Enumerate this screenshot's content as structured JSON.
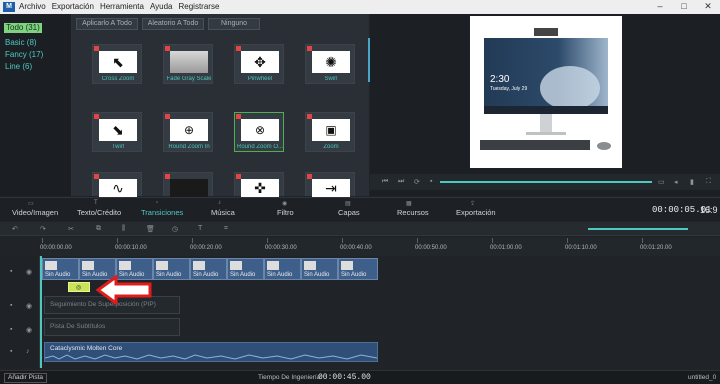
{
  "menu": {
    "logo": "M",
    "items": [
      "Archivo",
      "Exportación",
      "Herramienta",
      "Ayuda",
      "Registrarse"
    ],
    "window_controls": [
      "–",
      "□",
      "✕"
    ]
  },
  "categories": [
    {
      "label": "Todo (31)",
      "selected": true
    },
    {
      "label": "Basic (8)"
    },
    {
      "label": "Fancy (17)"
    },
    {
      "label": "Line (6)"
    }
  ],
  "effects_toolbar": {
    "apply_all": "Aplicarlo A Todo",
    "random_all": "Aleatorio A Todo",
    "none": "Ninguno"
  },
  "transitions": [
    {
      "label": "Cross Zoom",
      "icon": "arrow-corner-icon"
    },
    {
      "label": "Fade Gray Scale",
      "icon": "gray-fade-icon"
    },
    {
      "label": "Pinwheel",
      "icon": "pinwheel-icon"
    },
    {
      "label": "Swirl",
      "icon": "swirl-icon"
    },
    {
      "label": "Twirl",
      "icon": "twirl-icon"
    },
    {
      "label": "Round Zoom In",
      "icon": "zoom-in-arrows-icon"
    },
    {
      "label": "Round Zoom O...",
      "icon": "zoom-out-arrows-icon",
      "selected": true
    },
    {
      "label": "Zoom",
      "icon": "zoom-rect-icon"
    },
    {
      "label": "",
      "icon": "wave-icon"
    },
    {
      "label": "",
      "icon": "blob-icon"
    },
    {
      "label": "",
      "icon": "cross-arrows-icon"
    },
    {
      "label": "",
      "icon": "arrow-into-box-icon"
    }
  ],
  "preview": {
    "time_display": "2:30",
    "date_display": "Tuesday, July 29"
  },
  "tabs": [
    {
      "label": "Video/Imagen"
    },
    {
      "label": "Texto/Crédito"
    },
    {
      "label": "Transiciones",
      "active": true
    },
    {
      "label": "Música"
    },
    {
      "label": "Filtro"
    },
    {
      "label": "Capas"
    },
    {
      "label": "Recursos"
    },
    {
      "label": "Exportación"
    }
  ],
  "timecode": "00:00:05.01",
  "aspect_ratio": "16:9",
  "ruler_ticks": [
    "00:00:00.00",
    "00:00:10.00",
    "00:00:20.00",
    "00:00:30.00",
    "00:00:40.00",
    "00:00:50.00",
    "00:01:00.00",
    "00:01:10.00",
    "00:01:20.00"
  ],
  "clips": [
    {
      "label": "Sin Audio"
    },
    {
      "label": "Sin Audio"
    },
    {
      "label": "Sin Audio"
    },
    {
      "label": "Sin Audio"
    },
    {
      "label": "Sin Audio"
    },
    {
      "label": "Sin Audio"
    },
    {
      "label": "Sin Audio"
    },
    {
      "label": "Sin Audio"
    },
    {
      "label": "Sin Audio"
    }
  ],
  "tracks": {
    "pip": "Seguimiento De Superposición (PIP)",
    "subtitles": "Pista De Subtítulos",
    "audio": "Cataclysmic Molten Core"
  },
  "status": {
    "add_track": "Añadir Pista",
    "project_time_label": "Tiempo De Ingeniería:",
    "project_time": "00:00:45.00",
    "project_name": "untitled_0"
  },
  "colors": {
    "accent": "#4ec9c0",
    "selected_category": "#7fd27f",
    "annotation_arrow": "#e31b1b"
  }
}
